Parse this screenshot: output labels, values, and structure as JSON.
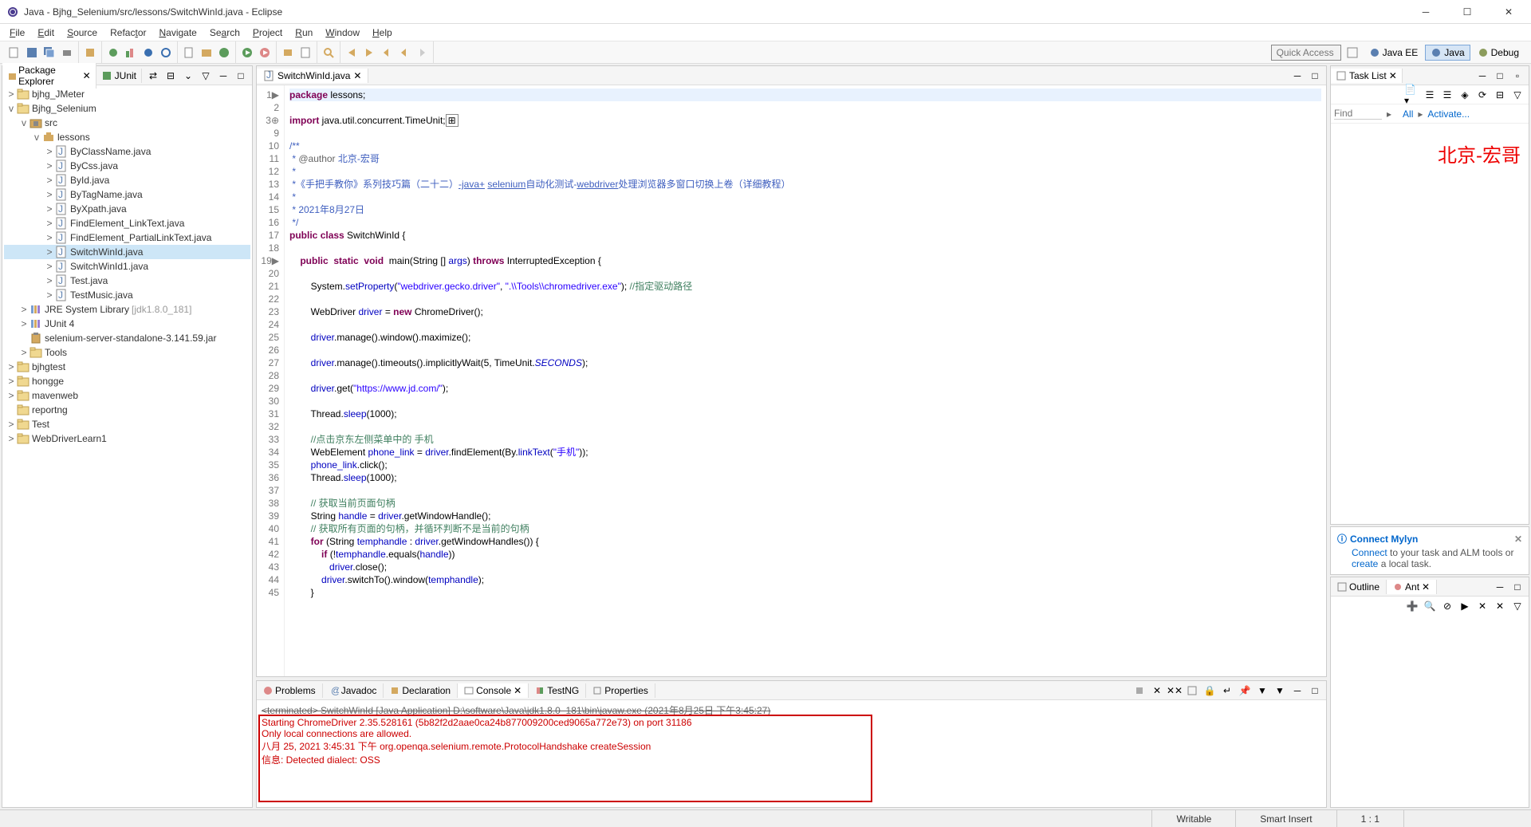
{
  "window": {
    "title": "Java - Bjhg_Selenium/src/lessons/SwitchWinId.java - Eclipse"
  },
  "menubar": [
    "File",
    "Edit",
    "Source",
    "Refactor",
    "Navigate",
    "Search",
    "Project",
    "Run",
    "Window",
    "Help"
  ],
  "quick_access_placeholder": "Quick Access",
  "perspectives": [
    {
      "label": "Java EE",
      "active": false
    },
    {
      "label": "Java",
      "active": true
    },
    {
      "label": "Debug",
      "active": false
    }
  ],
  "package_explorer": {
    "tab_label": "Package Explorer",
    "other_tab": "JUnit",
    "items": [
      {
        "indent": 0,
        "toggle": ">",
        "icon": "project",
        "label": "bjhg_JMeter"
      },
      {
        "indent": 0,
        "toggle": "v",
        "icon": "project",
        "label": "Bjhg_Selenium"
      },
      {
        "indent": 1,
        "toggle": "v",
        "icon": "src-folder",
        "label": "src"
      },
      {
        "indent": 2,
        "toggle": "v",
        "icon": "package",
        "label": "lessons"
      },
      {
        "indent": 3,
        "toggle": ">",
        "icon": "java",
        "label": "ByClassName.java"
      },
      {
        "indent": 3,
        "toggle": ">",
        "icon": "java",
        "label": "ByCss.java"
      },
      {
        "indent": 3,
        "toggle": ">",
        "icon": "java",
        "label": "ById.java"
      },
      {
        "indent": 3,
        "toggle": ">",
        "icon": "java",
        "label": "ByTagName.java"
      },
      {
        "indent": 3,
        "toggle": ">",
        "icon": "java",
        "label": "ByXpath.java"
      },
      {
        "indent": 3,
        "toggle": ">",
        "icon": "java",
        "label": "FindElement_LinkText.java"
      },
      {
        "indent": 3,
        "toggle": ">",
        "icon": "java",
        "label": "FindElement_PartialLinkText.java"
      },
      {
        "indent": 3,
        "toggle": ">",
        "icon": "java",
        "label": "SwitchWinId.java",
        "selected": true
      },
      {
        "indent": 3,
        "toggle": ">",
        "icon": "java",
        "label": "SwitchWinId1.java"
      },
      {
        "indent": 3,
        "toggle": ">",
        "icon": "java",
        "label": "Test.java"
      },
      {
        "indent": 3,
        "toggle": ">",
        "icon": "java",
        "label": "TestMusic.java"
      },
      {
        "indent": 1,
        "toggle": ">",
        "icon": "library",
        "label": "JRE System Library",
        "extra": "[jdk1.8.0_181]"
      },
      {
        "indent": 1,
        "toggle": ">",
        "icon": "library",
        "label": "JUnit 4"
      },
      {
        "indent": 1,
        "toggle": "",
        "icon": "jar",
        "label": "selenium-server-standalone-3.141.59.jar"
      },
      {
        "indent": 1,
        "toggle": ">",
        "icon": "folder",
        "label": "Tools"
      },
      {
        "indent": 0,
        "toggle": ">",
        "icon": "project",
        "label": "bjhgtest"
      },
      {
        "indent": 0,
        "toggle": ">",
        "icon": "project",
        "label": "hongge"
      },
      {
        "indent": 0,
        "toggle": ">",
        "icon": "project",
        "label": "mavenweb"
      },
      {
        "indent": 0,
        "toggle": "",
        "icon": "folder",
        "label": "reportng"
      },
      {
        "indent": 0,
        "toggle": ">",
        "icon": "project",
        "label": "Test"
      },
      {
        "indent": 0,
        "toggle": ">",
        "icon": "project",
        "label": "WebDriverLearn1"
      }
    ]
  },
  "editor": {
    "tab_label": "SwitchWinId.java",
    "line_numbers": [
      "1",
      "2",
      "3",
      "9",
      "10",
      "11",
      "12",
      "13",
      "14",
      "15",
      "16",
      "17",
      "18",
      "19",
      "20",
      "21",
      "22",
      "23",
      "24",
      "25",
      "26",
      "27",
      "28",
      "29",
      "30",
      "31",
      "32",
      "33",
      "34",
      "35",
      "36",
      "37",
      "38",
      "39",
      "40",
      "41",
      "42",
      "43",
      "44",
      "45"
    ],
    "gutter_marks": {
      "1": "▶",
      "3": "⊕",
      "19": "▶"
    }
  },
  "bottom": {
    "tabs": [
      "Problems",
      "Javadoc",
      "Declaration",
      "Console",
      "TestNG",
      "Properties"
    ],
    "active_tab": "Console",
    "terminated": "<terminated> SwitchWinId [Java Application] D:\\software\\Java\\jdk1.8.0_181\\bin\\javaw.exe (2021年8月25日 下午3:45:27)",
    "lines": [
      "Starting ChromeDriver 2.35.528161 (5b82f2d2aae0ca24b877009200ced9065a772e73) on port 31186",
      "Only local connections are allowed.",
      "八月 25, 2021 3:45:31 下午 org.openqa.selenium.remote.ProtocolHandshake createSession",
      "信息: Detected dialect: OSS"
    ]
  },
  "task_list": {
    "tab_label": "Task List",
    "find_placeholder": "Find",
    "all_label": "All",
    "activate_label": "Activate...",
    "watermark": "北京-宏哥"
  },
  "connect_mylyn": {
    "title": "Connect Mylyn",
    "text_pre": "Connect",
    "text_mid": " to your task and ALM tools or ",
    "text_post": "create",
    "text_end": " a local task."
  },
  "outline": {
    "tabs": [
      "Outline",
      "Ant"
    ]
  },
  "statusbar": {
    "writable": "Writable",
    "insert": "Smart Insert",
    "position": "1 : 1"
  }
}
